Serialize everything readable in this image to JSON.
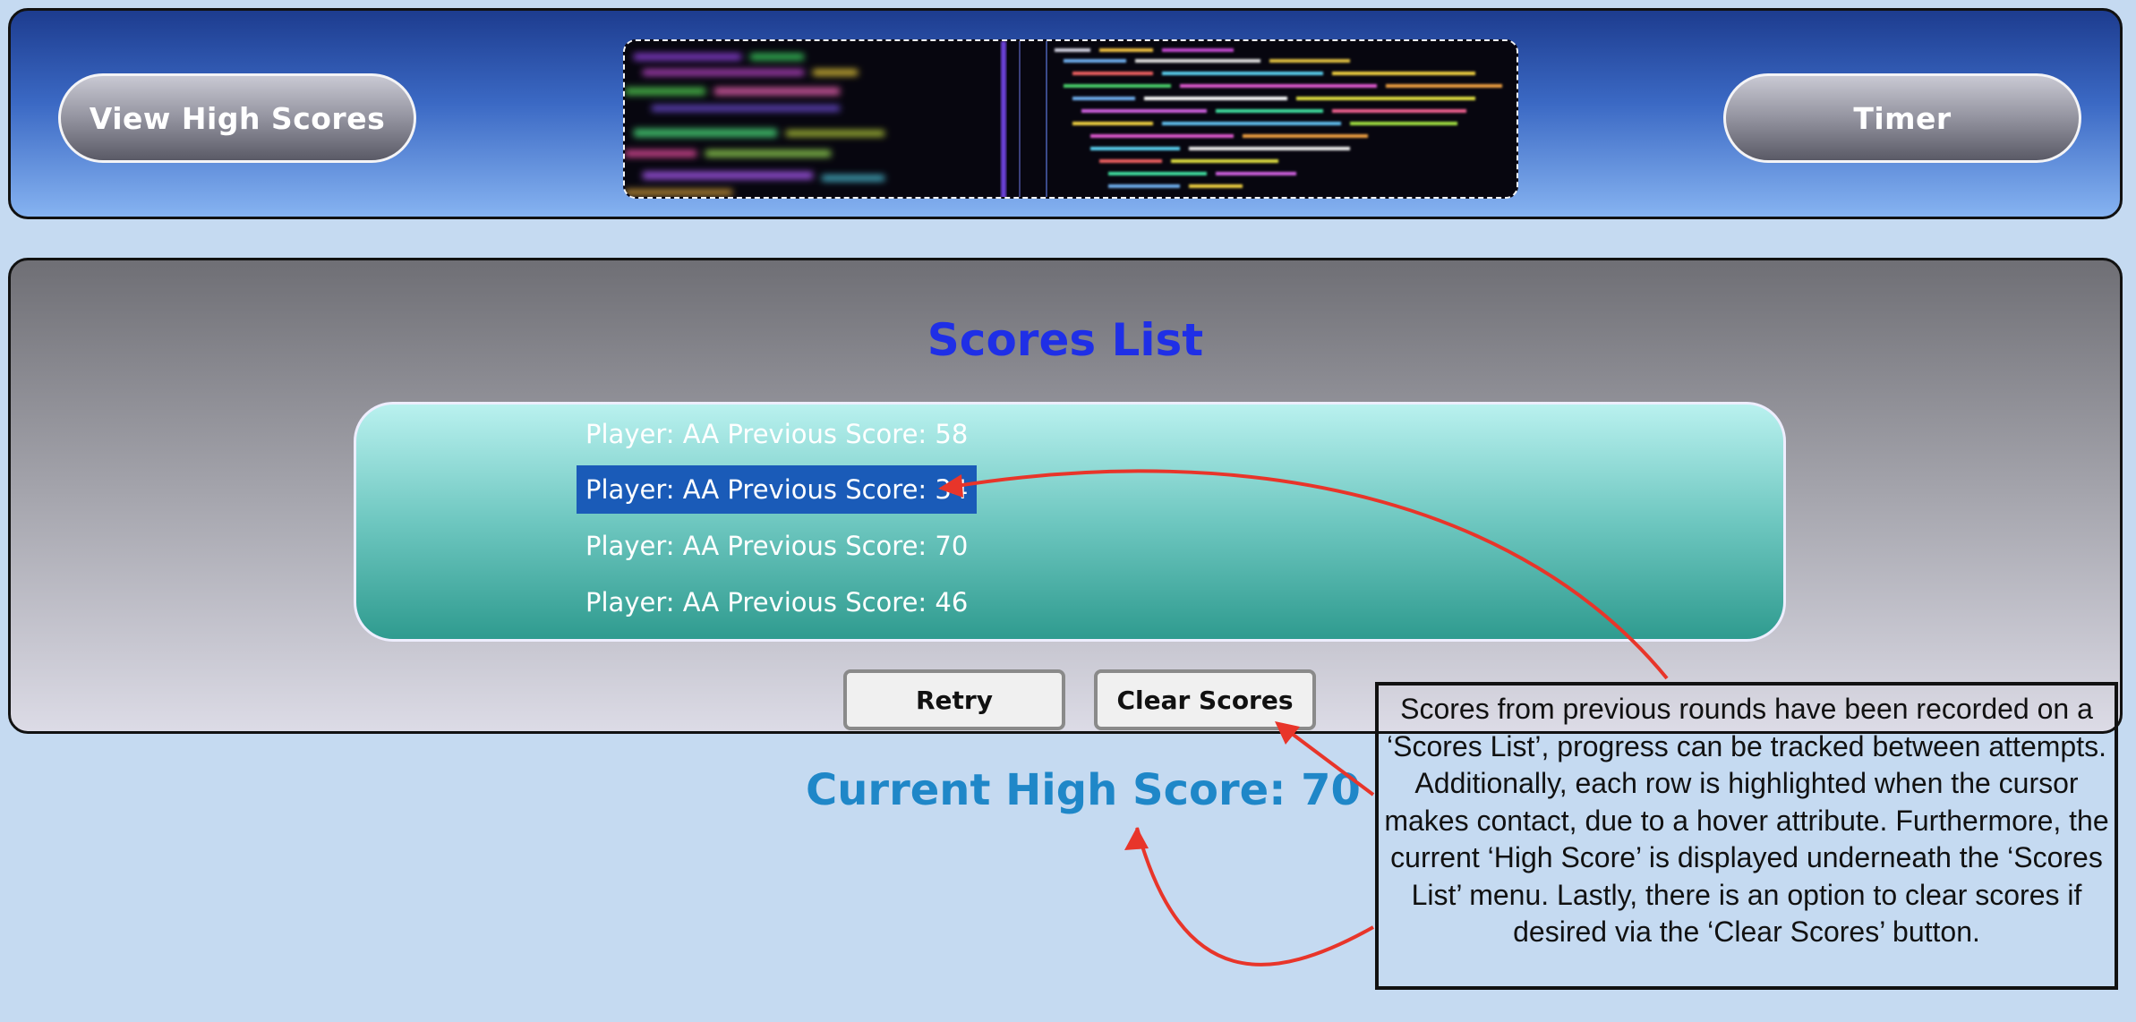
{
  "header": {
    "view_high_scores_label": "View High Scores",
    "timer_label": "Timer"
  },
  "panel": {
    "title": "Scores List",
    "scores": [
      {
        "text": "Player: AA Previous Score: 58",
        "player": "AA",
        "score": 58,
        "highlighted": false
      },
      {
        "text": "Player: AA Previous Score: 34",
        "player": "AA",
        "score": 34,
        "highlighted": true
      },
      {
        "text": "Player: AA Previous Score: 70",
        "player": "AA",
        "score": 70,
        "highlighted": false
      },
      {
        "text": "Player: AA Previous Score: 46",
        "player": "AA",
        "score": 46,
        "highlighted": false
      }
    ],
    "retry_label": "Retry",
    "clear_scores_label": "Clear Scores"
  },
  "high_score": {
    "text": "Current High Score: 70",
    "value": 70
  },
  "annotation": {
    "text": "Scores from previous rounds have been recorded on a ‘Scores List’, progress can be tracked between attempts. Additionally, each row is highlighted when the cursor makes contact, due to a hover attribute. Furthermore, the current ‘High Score’ is displayed underneath the ‘Scores List’ menu. Lastly, there is an option to clear scores if desired via the ‘Clear Scores’ button."
  },
  "colors": {
    "title": "#1f2fe6",
    "high_score": "#1f87c8",
    "row_highlight": "#1a5bb8",
    "arrow": "#e8352a"
  },
  "icons": {
    "banner": "code-editor-image"
  }
}
